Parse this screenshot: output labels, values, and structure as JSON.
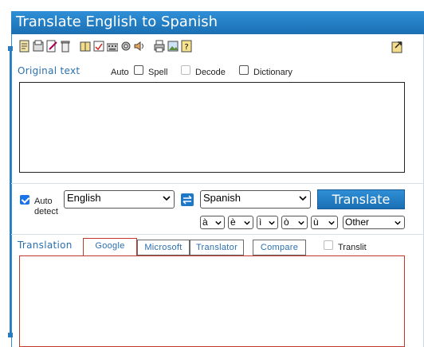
{
  "title": "Translate English to Spanish",
  "toolbar_icons": [
    "notepad-icon",
    "print-preview-icon",
    "edit-icon",
    "trash-icon",
    "book-icon",
    "spellcheck-icon",
    "keyboard-icon",
    "settings-icon",
    "speaker-icon",
    "printer-icon",
    "image-icon",
    "help-icon"
  ],
  "original": {
    "label": "Original text",
    "auto": "Auto",
    "spell": "Spell",
    "decode": "Decode",
    "dictionary": "Dictionary"
  },
  "controls": {
    "auto_detect_line1": "Auto",
    "auto_detect_line2": "detect",
    "source_lang": "English",
    "target_lang": "Spanish",
    "translate_button": "Translate",
    "accents": [
      "à",
      "è",
      "ì",
      "ò",
      "ù"
    ],
    "other": "Other"
  },
  "translation": {
    "label": "Translation",
    "tabs": [
      "Google",
      "Microsoft",
      "Translator",
      "Compare"
    ],
    "translit": "Translit"
  }
}
